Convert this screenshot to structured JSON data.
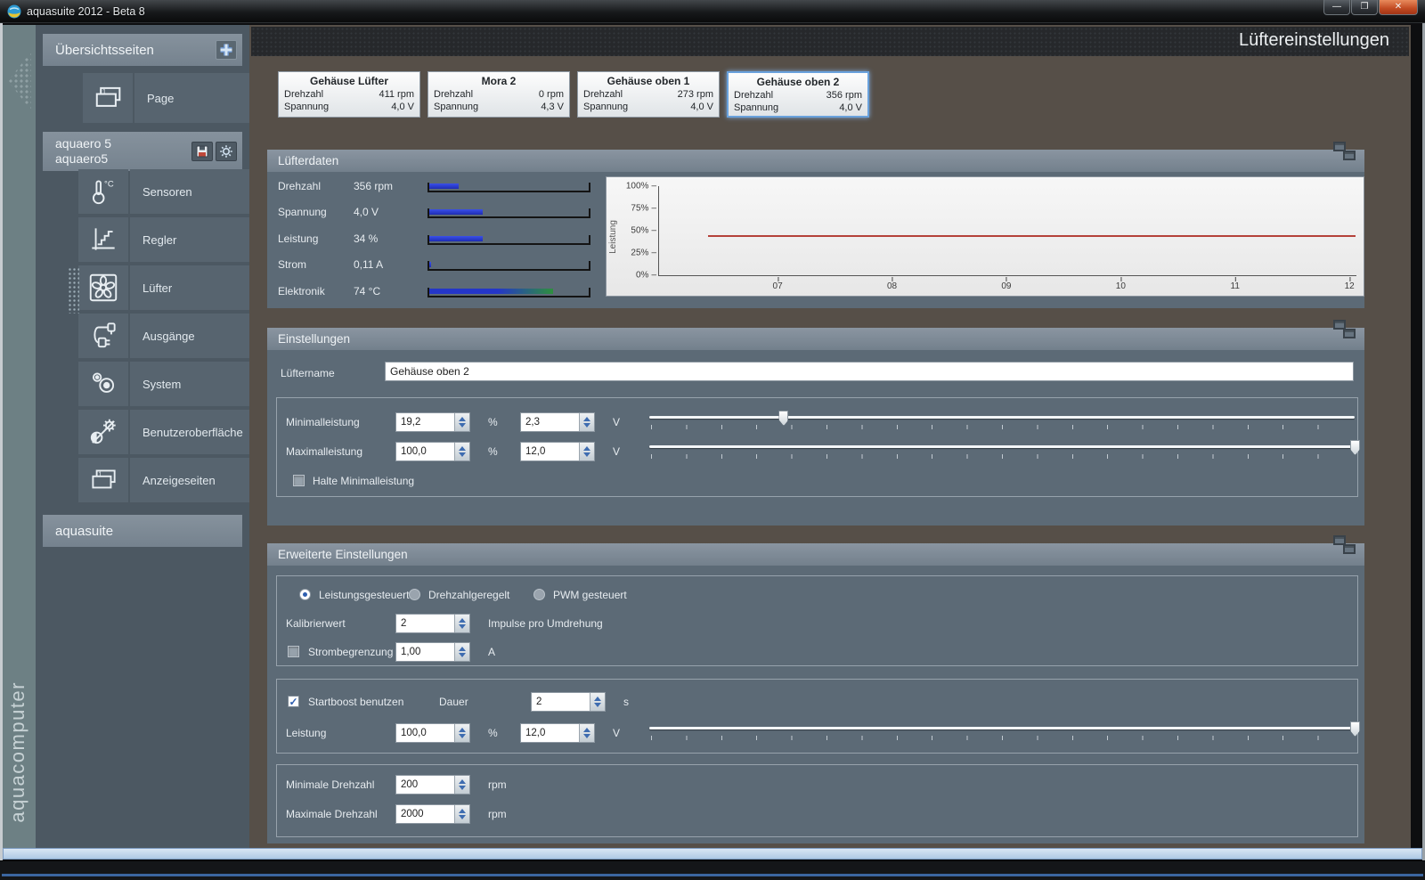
{
  "window": {
    "title": "aquasuite 2012 - Beta 8",
    "minimize_glyph": "—",
    "maximize_glyph": "❐",
    "close_glyph": "✕"
  },
  "page_title": "Lüftereinstellungen",
  "brand": "aquacomputer",
  "sidebar": {
    "overview_header": "Übersichtsseiten",
    "page_label": "Page",
    "device_name": "aquaero 5",
    "device_sub": "aquaero5",
    "items": [
      {
        "label": "Sensoren",
        "icon": "thermometer-icon"
      },
      {
        "label": "Regler",
        "icon": "controller-curve-icon"
      },
      {
        "label": "Lüfter",
        "icon": "fan-icon",
        "selected": true
      },
      {
        "label": "Ausgänge",
        "icon": "plug-icon"
      },
      {
        "label": "System",
        "icon": "gears-icon"
      },
      {
        "label": "Benutzeroberfläche",
        "icon": "display-contrast-icon"
      },
      {
        "label": "Anzeigeseiten",
        "icon": "pages-icon"
      }
    ],
    "footer_header": "aquasuite"
  },
  "cards": {
    "rpm_label": "Drehzahl",
    "volt_label": "Spannung",
    "list": [
      {
        "name": "Gehäuse Lüfter",
        "rpm": "411 rpm",
        "volt": "4,0 V",
        "selected": false
      },
      {
        "name": "Mora 2",
        "rpm": "0 rpm",
        "volt": "4,3 V",
        "selected": false
      },
      {
        "name": "Gehäuse oben 1",
        "rpm": "273 rpm",
        "volt": "4,0 V",
        "selected": false
      },
      {
        "name": "Gehäuse oben 2",
        "rpm": "356 rpm",
        "volt": "4,0 V",
        "selected": true
      }
    ]
  },
  "fan_data": {
    "title": "Lüfterdaten",
    "rows": [
      {
        "label": "Drehzahl",
        "value": "356 rpm",
        "fill_percent": 18,
        "style": "blue"
      },
      {
        "label": "Spannung",
        "value": "4,0 V",
        "fill_percent": 33,
        "style": "blue"
      },
      {
        "label": "Leistung",
        "value": "34 %",
        "fill_percent": 33,
        "style": "blue"
      },
      {
        "label": "Strom",
        "value": "0,11 A",
        "fill_percent": 1,
        "style": "blue"
      },
      {
        "label": "Elektronik",
        "value": "74 °C",
        "fill_percent": 76,
        "style": "gradient-blue-green"
      }
    ]
  },
  "chart_data": {
    "type": "line",
    "title": "",
    "xlabel": "",
    "ylabel": "Leistung",
    "yticks": [
      "100%",
      "75%",
      "50%",
      "25%",
      "0%"
    ],
    "xticks": [
      "07",
      "08",
      "09",
      "10",
      "11",
      "12"
    ],
    "ylim": [
      0,
      100
    ],
    "grid": false,
    "legend": "none",
    "line_value_percent": 43,
    "series": [
      {
        "name": "Leistung",
        "color": "#b5423a",
        "shape": "constant",
        "value_percent": 43,
        "x_span": [
          "06:20",
          "12:00"
        ]
      }
    ]
  },
  "settings": {
    "title": "Einstellungen",
    "fan_name_label": "Lüftername",
    "fan_name_value": "Gehäuse oben 2",
    "min_label": "Minimalleistung",
    "min_percent": "19,2",
    "min_volt": "2,3",
    "min_slider_percent": 19,
    "max_label": "Maximalleistung",
    "max_percent": "100,0",
    "max_volt": "12,0",
    "max_slider_percent": 100,
    "hold_min_label": "Halte Minimalleistung",
    "hold_min_checked": false
  },
  "advanced": {
    "title": "Erweiterte Einstellungen",
    "modes": [
      {
        "label": "Leistungsgesteuert",
        "selected": true
      },
      {
        "label": "Drehzahlgeregelt",
        "selected": false
      },
      {
        "label": "PWM gesteuert",
        "selected": false
      }
    ],
    "calibration_label": "Kalibrierwert",
    "calibration_value": "2",
    "calibration_unit": "Impulse pro Umdrehung",
    "current_limit_label": "Strombegrenzung",
    "current_limit_checked": false,
    "current_limit_value": "1,00",
    "startboost_label": "Startboost benutzen",
    "startboost_checked": true,
    "duration_label": "Dauer",
    "duration_value": "2",
    "boost_power_label": "Leistung",
    "boost_percent": "100,0",
    "boost_volt": "12,0",
    "boost_slider_percent": 100,
    "min_rpm_label": "Minimale Drehzahl",
    "min_rpm_value": "200",
    "max_rpm_label": "Maximale Drehzahl",
    "max_rpm_value": "2000"
  },
  "units": {
    "percent": "%",
    "volt": "V",
    "amp": "A",
    "sec": "s",
    "rpm": "rpm"
  },
  "check_glyph": "✓",
  "colors": {
    "accent_blue": "#2e5fb0",
    "bar_blue": "#2436c8",
    "bar_green": "#2e8f3e",
    "line_red": "#b5423a",
    "selected_card_border": "#69a1dc"
  }
}
